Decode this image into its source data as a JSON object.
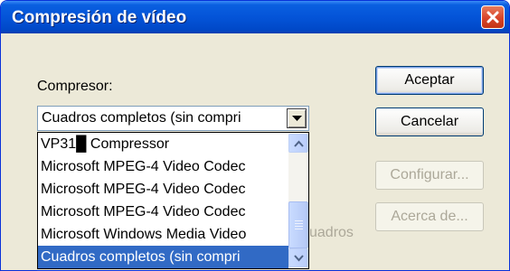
{
  "window": {
    "title": "Compresión de vídeo"
  },
  "compressor": {
    "label": "Compresor:",
    "selected": "Cuadros completos (sin compri"
  },
  "dropdown": {
    "items": [
      "VP31█ Compressor",
      "Microsoft MPEG-4 Video Codec",
      "Microsoft MPEG-4 Video Codec",
      "Microsoft MPEG-4 Video Codec",
      "Microsoft Windows Media Video",
      "Cuadros completos (sin compri"
    ],
    "selected_index": 5
  },
  "buttons": {
    "accept": "Aceptar",
    "cancel": "Cancelar",
    "configure": "Configurar...",
    "about": "Acerca de..."
  },
  "hidden_label_fragment": "uadros",
  "colors": {
    "accent": "#316ac5",
    "titlebar": "#0454d8",
    "close": "#d8442a"
  }
}
